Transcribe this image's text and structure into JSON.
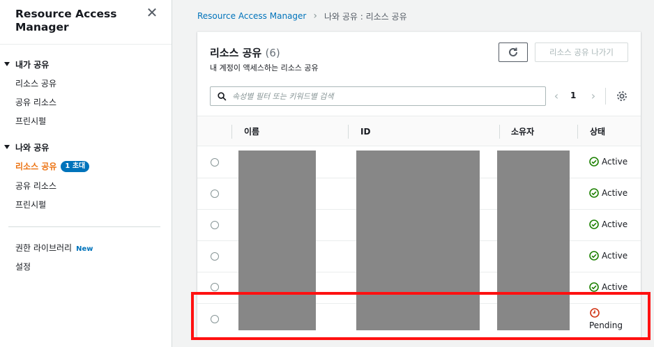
{
  "sidebar": {
    "title": "Resource Access Manager",
    "shared_by_me": {
      "title": "내가 공유",
      "items": [
        {
          "label": "리소스 공유"
        },
        {
          "label": "공유 리소스"
        },
        {
          "label": "프린시펄"
        }
      ]
    },
    "shared_with_me": {
      "title": "나와 공유",
      "items": [
        {
          "label": "리소스 공유",
          "badge": "1 초대"
        },
        {
          "label": "공유 리소스"
        },
        {
          "label": "프린시펄"
        }
      ]
    },
    "permissions_library": {
      "label": "권한 라이브러리",
      "tag": "New"
    },
    "settings": {
      "label": "설정"
    }
  },
  "breadcrumb": {
    "root": "Resource Access Manager",
    "current": "나와 공유 : 리소스 공유"
  },
  "panel": {
    "title": "리소스 공유",
    "count": "(6)",
    "description": "내 계정이 액세스하는 리소스 공유",
    "leave_button": "리소스 공유 나가기",
    "search_placeholder": "속성별 필터 또는 키워드별 검색",
    "page": "1"
  },
  "table": {
    "columns": [
      "이름",
      "ID",
      "소유자",
      "상태"
    ],
    "rows": [
      {
        "status": "Active"
      },
      {
        "status": "Active"
      },
      {
        "status": "Active"
      },
      {
        "status": "Active"
      },
      {
        "status": "Active"
      },
      {
        "status": "Pending"
      }
    ]
  },
  "colors": {
    "active_green": "#1d8102",
    "pending_red": "#d13212",
    "highlight": "#ff1111",
    "accent_orange": "#ec7211",
    "link_blue": "#0073bb"
  }
}
